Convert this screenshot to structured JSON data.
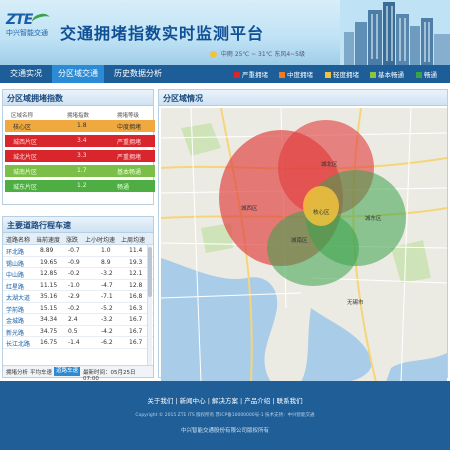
{
  "header": {
    "logo_main": "ZTE",
    "logo_sub": "中兴智能交通",
    "title": "交通拥堵指数实时监测平台",
    "weather": "中雨 25℃ ~ 31℃ 东风4~5级"
  },
  "nav": {
    "tabs": [
      {
        "label": "交通实况",
        "active": false
      },
      {
        "label": "分区域交通",
        "active": true
      },
      {
        "label": "历史数据分析",
        "active": false
      }
    ],
    "legend": [
      {
        "label": "严重拥堵",
        "color": "#d9252c"
      },
      {
        "label": "中度拥堵",
        "color": "#f07c22"
      },
      {
        "label": "轻度拥堵",
        "color": "#f3c23c"
      },
      {
        "label": "基本畅通",
        "color": "#8cc63f"
      },
      {
        "label": "畅通",
        "color": "#3aa34a"
      }
    ]
  },
  "area_panel": {
    "title": "分区域拥堵指数",
    "columns": [
      "区域名称",
      "拥堵指数",
      "拥堵等级"
    ],
    "rows": [
      {
        "name": "核心区",
        "index": "1.8",
        "level": "中度拥堵",
        "color": "#f0a93e"
      },
      {
        "name": "城西片区",
        "index": "3.4",
        "level": "严重拥堵",
        "color": "#d9252c"
      },
      {
        "name": "城北片区",
        "index": "3.3",
        "level": "严重拥堵",
        "color": "#d9252c"
      },
      {
        "name": "城南片区",
        "index": "1.7",
        "level": "基本畅通",
        "color": "#7bbf49"
      },
      {
        "name": "城东片区",
        "index": "1.2",
        "level": "畅通",
        "color": "#4fae43"
      }
    ]
  },
  "speed_panel": {
    "title": "主要道路行程车速",
    "columns": [
      "道路名称",
      "当前速度",
      "涨跌",
      "上小时均速",
      "上周均速"
    ],
    "rows": [
      [
        "环北路",
        "8.89",
        "-0.7",
        "1.0",
        "11.4"
      ],
      [
        "锡山路",
        "19.65",
        "-0.9",
        "8.9",
        "19.3"
      ],
      [
        "中山路",
        "12.85",
        "-0.2",
        "-3.2",
        "12.1"
      ],
      [
        "红星路",
        "11.15",
        "-1.0",
        "-4.7",
        "12.8"
      ],
      [
        "太湖大道",
        "35.16",
        "-2.9",
        "-7.1",
        "16.8"
      ],
      [
        "学前路",
        "15.15",
        "-0.2",
        "-5.2",
        "16.3"
      ],
      [
        "金城路",
        "34.34",
        "2.4",
        "-3.2",
        "16.7"
      ],
      [
        "新光路",
        "34.75",
        "0.5",
        "-4.2",
        "16.7"
      ],
      [
        "长江北路",
        "16.75",
        "-1.4",
        "-6.2",
        "16.7"
      ]
    ],
    "bottom_tabs": [
      "拥堵分析",
      "平均车速",
      "道路车速"
    ],
    "update_time": "最新时间：05月25日 07:00"
  },
  "map_panel": {
    "title": "分区域情况",
    "labels": {
      "north": "城北区",
      "west": "城西区",
      "core": "核心区",
      "east": "城东区",
      "south": "城南区",
      "lake": "无锡市"
    }
  },
  "footer": {
    "links": "关于我们 | 新闻中心 | 解决方案 | 产品介绍 | 联系我们",
    "copyright": "Copyright © 2015 ZTE ITS 版权所有 苏ICP备10000000号-1 技术支持：中兴智能交通",
    "company": "中兴智能交通股份有限公司版权所有"
  }
}
